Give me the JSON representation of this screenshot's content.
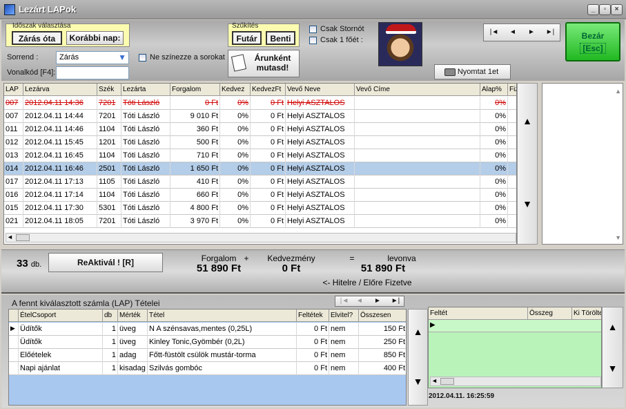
{
  "window": {
    "title": "Lezárt LAPok"
  },
  "period": {
    "caption": "Időszak választása",
    "since_close": "Zárás óta",
    "earlier_day": "Korábbi nap:"
  },
  "narrow": {
    "caption": "Szűkítés",
    "courier": "Futár",
    "inside": "Benti"
  },
  "filters": {
    "only_storno": "Csak Stornót",
    "only_one_person": "Csak 1 főét :",
    "no_color_rows": "Ne színezze a sorokat"
  },
  "sort": {
    "label": "Sorrend :",
    "value": "Zárás"
  },
  "barcode": {
    "label": "Vonalkód [F4]:",
    "value": ""
  },
  "price_button": "Árunként mutasd!",
  "print_button": "Nyomtat 1et",
  "close_button": {
    "line1": "Bezár",
    "line2": "[Esc]"
  },
  "nav": [
    "|◄",
    "◄",
    "►",
    "►|"
  ],
  "main_table": {
    "columns": [
      "LAP",
      "Lezárva",
      "Szék",
      "Lezárta",
      "Forgalom",
      "Kedvez",
      "KedvezFt",
      "Vevő Neve",
      "Vevő Címe",
      "Alap%",
      "Fiz"
    ],
    "rows": [
      {
        "lap": "007",
        "closed": "2012.04.11 14:36",
        "seat": "7201",
        "by": "Tóti László",
        "turnover": "0 Ft",
        "disc": "0%",
        "discft": "0 Ft",
        "name": "Helyi ASZTALOS",
        "addr": "",
        "base": "0%",
        "storno": true
      },
      {
        "lap": "007",
        "closed": "2012.04.11 14:44",
        "seat": "7201",
        "by": "Tóti László",
        "turnover": "9 010 Ft",
        "disc": "0%",
        "discft": "0 Ft",
        "name": "Helyi ASZTALOS",
        "addr": "",
        "base": "0%"
      },
      {
        "lap": "011",
        "closed": "2012.04.11 14:46",
        "seat": "1104",
        "by": "Tóti László",
        "turnover": "360 Ft",
        "disc": "0%",
        "discft": "0 Ft",
        "name": "Helyi ASZTALOS",
        "addr": "",
        "base": "0%"
      },
      {
        "lap": "012",
        "closed": "2012.04.11 15:45",
        "seat": "1201",
        "by": "Tóti László",
        "turnover": "500 Ft",
        "disc": "0%",
        "discft": "0 Ft",
        "name": "Helyi ASZTALOS",
        "addr": "",
        "base": "0%"
      },
      {
        "lap": "013",
        "closed": "2012.04.11 16:45",
        "seat": "1104",
        "by": "Tóti László",
        "turnover": "710 Ft",
        "disc": "0%",
        "discft": "0 Ft",
        "name": "Helyi ASZTALOS",
        "addr": "",
        "base": "0%"
      },
      {
        "lap": "014",
        "closed": "2012.04.11 16:46",
        "seat": "2501",
        "by": "Tóti László",
        "turnover": "1 650 Ft",
        "disc": "0%",
        "discft": "0 Ft",
        "name": "Helyi ASZTALOS",
        "addr": "",
        "base": "0%",
        "selected": true
      },
      {
        "lap": "017",
        "closed": "2012.04.11 17:13",
        "seat": "1105",
        "by": "Tóti László",
        "turnover": "410 Ft",
        "disc": "0%",
        "discft": "0 Ft",
        "name": "Helyi ASZTALOS",
        "addr": "",
        "base": "0%"
      },
      {
        "lap": "016",
        "closed": "2012.04.11 17:14",
        "seat": "1104",
        "by": "Tóti László",
        "turnover": "660 Ft",
        "disc": "0%",
        "discft": "0 Ft",
        "name": "Helyi ASZTALOS",
        "addr": "",
        "base": "0%"
      },
      {
        "lap": "015",
        "closed": "2012.04.11 17:30",
        "seat": "5301",
        "by": "Tóti László",
        "turnover": "4 800 Ft",
        "disc": "0%",
        "discft": "0 Ft",
        "name": "Helyi ASZTALOS",
        "addr": "",
        "base": "0%"
      },
      {
        "lap": "021",
        "closed": "2012.04.11 18:05",
        "seat": "7201",
        "by": "Tóti László",
        "turnover": "3 970 Ft",
        "disc": "0%",
        "discft": "0 Ft",
        "name": "Helyi ASZTALOS",
        "addr": "",
        "base": "0%"
      }
    ]
  },
  "summary": {
    "count": "33",
    "count_unit": "db.",
    "reactivate": "ReAktivál ! [R]",
    "turnover_label": "Forgalom",
    "plus": "+",
    "discount_label": "Kedvezmény",
    "equals": "=",
    "deducted_label": "levonva",
    "turnover_value": "51 890 Ft",
    "discount_value": "0 Ft",
    "deducted_value": "51 890 Ft",
    "credit_note": "<- Hitelre / Előre Fizetve"
  },
  "items": {
    "title": "A fennt kiválasztott számla (LAP) Tételei",
    "columns": [
      "ÉtelCsoport",
      "db",
      "Mérték",
      "Tétel",
      "Feltétek",
      "Elvitel?",
      "Összesen"
    ],
    "rows": [
      {
        "group": "Üdítők",
        "qty": "1",
        "unit": "üveg",
        "item": "N A szénsavas,mentes (0,25L)",
        "extras": "0 Ft",
        "takeaway": "nem",
        "total": "150 Ft",
        "current": true
      },
      {
        "group": "Üdítők",
        "qty": "1",
        "unit": "üveg",
        "item": "Kinley Tonic,Gyömbér (0,2L)",
        "extras": "0 Ft",
        "takeaway": "nem",
        "total": "250 Ft"
      },
      {
        "group": "Előételek",
        "qty": "1",
        "unit": "adag",
        "item": "Főtt-füstölt csülök mustár-torma",
        "extras": "0 Ft",
        "takeaway": "nem",
        "total": "850 Ft"
      },
      {
        "group": "Napi ajánlat",
        "qty": "1",
        "unit": "kisadag",
        "item": "Szilvás gombóc",
        "extras": "0 Ft",
        "takeaway": "nem",
        "total": "400 Ft"
      }
    ]
  },
  "extras_table": {
    "columns": [
      "Feltét",
      "Összeg",
      "Ki Törölte"
    ]
  },
  "timestamp": "2012.04.11. 16:25:59",
  "colors": {
    "selected_row": "#b4cde8",
    "storno": "#d00000",
    "items_bg": "#a9c8f0",
    "extras_bg": "#b9f3b9",
    "close_green": "#22b822"
  }
}
